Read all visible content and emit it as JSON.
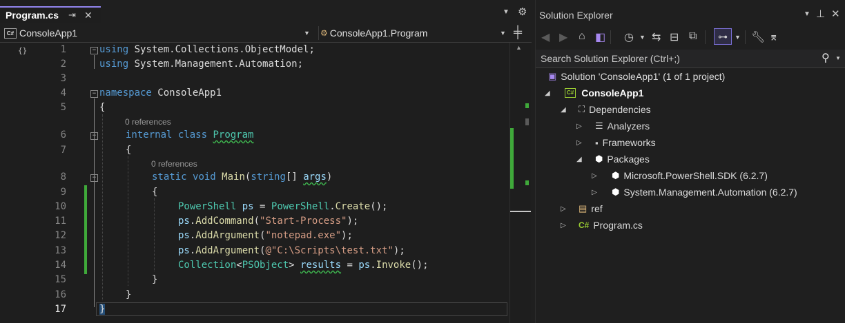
{
  "editor": {
    "tab_title": "Program.cs",
    "tab_pin": "⇥",
    "tab_close": "✕",
    "project_dropdown": "ConsoleApp1",
    "class_dropdown": "ConsoleApp1.Program",
    "csharp_badge": "C#",
    "references_6": "0 references",
    "references_8": "0 references",
    "lines": [
      "1",
      "2",
      "3",
      "4",
      "5",
      "6",
      "7",
      "8",
      "9",
      "10",
      "11",
      "12",
      "13",
      "14",
      "15",
      "16",
      "17"
    ],
    "code": {
      "l1_kw": "using",
      "l1_rest": " System.Collections.ObjectModel;",
      "l2_kw": "using",
      "l2_rest": " System.Management.Automation;",
      "l4_kw": "namespace",
      "l4_rest": " ConsoleApp1",
      "l5": "{",
      "l6_kw1": "internal",
      "l6_kw2": "class",
      "l6_name": "Program",
      "l7": "{",
      "l8_kw1": "static",
      "l8_kw2": "void",
      "l8_fn": "Main",
      "l8_open": "(",
      "l8_type": "string",
      "l8_br": "[] ",
      "l8_param": "args",
      "l8_close": ")",
      "l9": "{",
      "l10_t1": "PowerShell",
      "l10_v": "ps",
      "l10_eq": " = ",
      "l10_t2": "PowerShell",
      "l10_dot": ".",
      "l10_fn": "Create",
      "l10_end": "();",
      "l11_v": "ps",
      "l11_dot": ".",
      "l11_fn": "AddCommand",
      "l11_open": "(",
      "l11_str": "\"Start-Process\"",
      "l11_end": ");",
      "l12_v": "ps",
      "l12_dot": ".",
      "l12_fn": "AddArgument",
      "l12_open": "(",
      "l12_str": "\"notepad.exe\"",
      "l12_end": ");",
      "l13_v": "ps",
      "l13_dot": ".",
      "l13_fn": "AddArgument",
      "l13_open": "(",
      "l13_str": "@\"C:\\Scripts\\test.txt\"",
      "l13_end": ");",
      "l14_t1": "Collection",
      "l14_lt": "<",
      "l14_t2": "PSObject",
      "l14_gt": "> ",
      "l14_v": "results",
      "l14_eq": " = ",
      "l14_v2": "ps",
      "l14_dot": ".",
      "l14_fn": "Invoke",
      "l14_end": "();",
      "l15": "}",
      "l16": "}",
      "l17": "}"
    }
  },
  "solution_explorer": {
    "title": "Solution Explorer",
    "search_placeholder": "Search Solution Explorer (Ctrl+;)",
    "solution": "Solution 'ConsoleApp1' (1 of 1 project)",
    "project": "ConsoleApp1",
    "dependencies": "Dependencies",
    "analyzers": "Analyzers",
    "frameworks": "Frameworks",
    "packages": "Packages",
    "pkg1": "Microsoft.PowerShell.SDK (6.2.7)",
    "pkg2": "System.Management.Automation (6.2.7)",
    "ref": "ref",
    "program_cs": "Program.cs",
    "csharp_badge": "C#"
  },
  "colors": {
    "accent": "#9184ee",
    "change_bar": "#3fa93a",
    "keyword": "#569cd6",
    "type": "#4ec9b0"
  }
}
